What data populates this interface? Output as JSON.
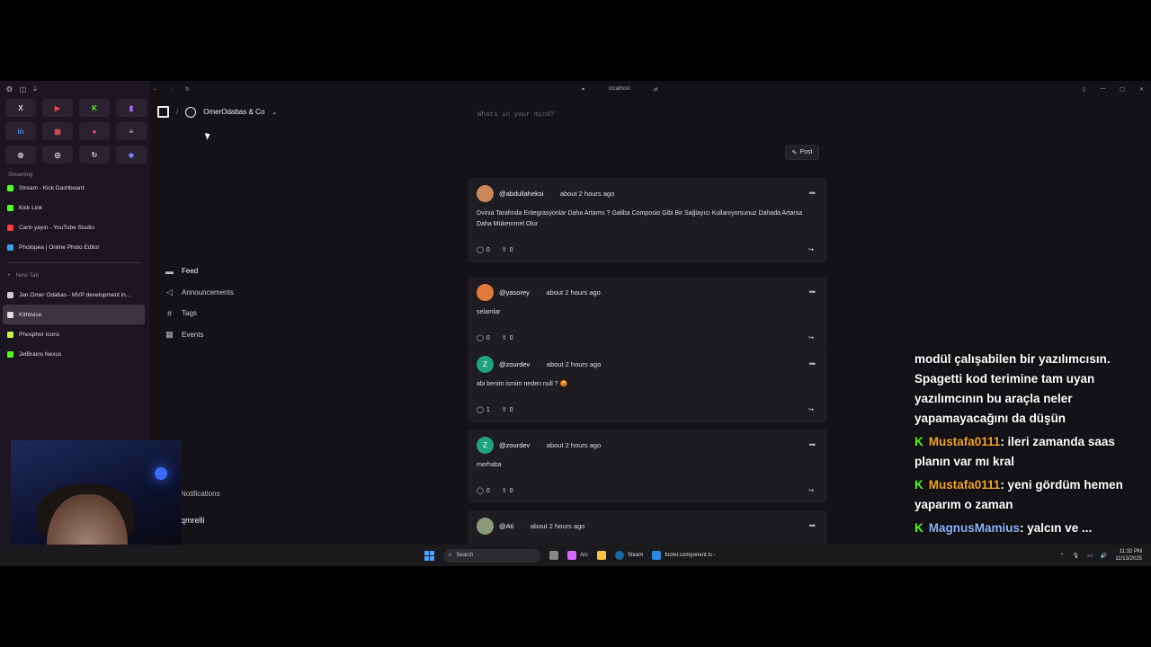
{
  "browser": {
    "url": "localhost",
    "favorites": [
      {
        "label": "X",
        "color": "#dddddd"
      },
      {
        "label": "▶",
        "color": "#ff3b3b"
      },
      {
        "label": "K",
        "color": "#53fc18"
      },
      {
        "label": "▮",
        "color": "#a970ff"
      },
      {
        "label": "in",
        "color": "#4a90d9"
      },
      {
        "label": "▦",
        "color": "#e24a4a"
      },
      {
        "label": "●",
        "color": "#ff4d6d"
      },
      {
        "label": "≡",
        "color": "#cccccc"
      },
      {
        "label": "◍",
        "color": "#bbbbbb"
      },
      {
        "label": "◎",
        "color": "#dddddd"
      },
      {
        "label": "↻",
        "color": "#cccccc"
      },
      {
        "label": "◆",
        "color": "#7b7bff"
      }
    ],
    "section_label": "Streaming",
    "tabs_top": [
      {
        "title": "Stream - Kick Dashboard",
        "color": "#53fc18"
      },
      {
        "title": "Kick Link",
        "color": "#53fc18"
      },
      {
        "title": "Canlı yayın - YouTube Studio",
        "color": "#ff3b3b"
      },
      {
        "title": "Photopea | Online Photo Editor",
        "color": "#3a9de0"
      }
    ],
    "new_tab": "New Tab",
    "tabs_bottom": [
      {
        "title": "Jan Omer Odabas - MVP development in...",
        "color": "#cccccc",
        "active": false
      },
      {
        "title": "Kithbase",
        "color": "#dddddd",
        "active": true
      },
      {
        "title": "Phosphor Icons",
        "color": "#c6f04a",
        "active": false
      },
      {
        "title": "JetBrains Nexus",
        "color": "#53fc18",
        "active": false
      }
    ]
  },
  "app": {
    "org_name": "OmerOdabas & Co",
    "composer_placeholder": "Whats in your mind?",
    "post_button": "Post",
    "nav": [
      {
        "label": "Feed",
        "icon": "▬",
        "active": true
      },
      {
        "label": "Announcements",
        "icon": "◁",
        "active": false
      },
      {
        "label": "Tags",
        "icon": "#",
        "active": false
      },
      {
        "label": "Events",
        "icon": "▦",
        "active": false
      }
    ],
    "notifications_label": "Notifications",
    "user_label": "qmrelli",
    "posts": [
      {
        "handle": "@abdullaheksi",
        "time": "about 2 hours ago",
        "avatar": "",
        "avatar_color": "#c9875a",
        "body": "Dvinia Tarafında Entegrasyonlar Daha Artarmı ? Galiba Composio Gibi Bir Sağlayıcı Kullanıyorsunuz Dahada Artarsa Daha Mükemmel Olur",
        "comments": "0",
        "upvotes": "0"
      },
      {
        "handle": "@yasorey",
        "time": "about 2 hours ago",
        "avatar": "",
        "avatar_color": "#e07a3a",
        "body": "selamlar",
        "comments": "0",
        "upvotes": "0"
      },
      {
        "handle": "@zourdev",
        "time": "about 2 hours ago",
        "avatar": "Z",
        "avatar_color": "#1ea37a",
        "body": "abi benim ismim neden null ? 😡",
        "comments": "1",
        "upvotes": "0"
      },
      {
        "handle": "@zourdev",
        "time": "about 2 hours ago",
        "avatar": "Z",
        "avatar_color": "#1ea37a",
        "body": "merhaba",
        "comments": "0",
        "upvotes": "0"
      },
      {
        "handle": "@Ati",
        "time": "about 2 hours ago",
        "avatar": "",
        "avatar_color": "#8a9a7a",
        "body": "",
        "comments": "",
        "upvotes": ""
      }
    ]
  },
  "chat": {
    "partial": "modül çalışabilen bir yazılımcısın. Spagetti kod terimine tam uyan yazılımcının bu araçla neler yapamayacağını da düşün",
    "messages": [
      {
        "user": "Mustafa0111",
        "text": ": ileri zamanda saas planın var mı kral",
        "user_color": "#f5a623"
      },
      {
        "user": "Mustafa0111",
        "text": ": yeni gördüm hemen yaparım o zaman",
        "user_color": "#f5a623"
      },
      {
        "user": "MagnusMamius",
        "text": ": yalcın ve ...",
        "user_color": "#8ab4f8"
      }
    ]
  },
  "taskbar": {
    "search_label": "Search",
    "apps": [
      "Arc",
      "Steam",
      "footer.component.ts - "
    ],
    "time": "11:32 PM",
    "date": "11/13/2025"
  }
}
